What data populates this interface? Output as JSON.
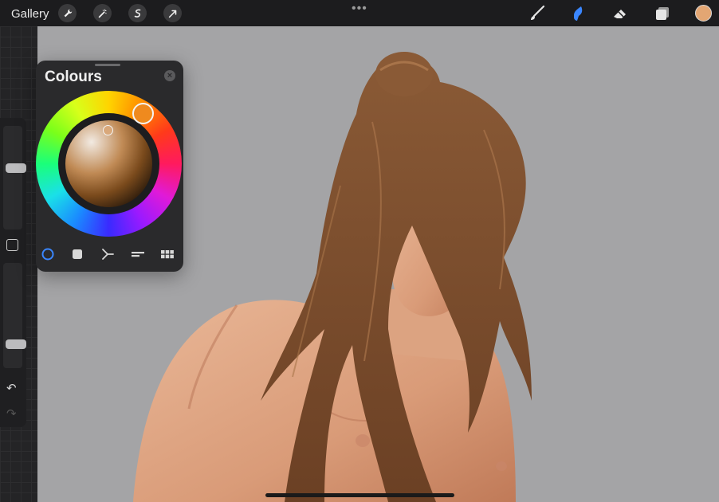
{
  "topbar": {
    "gallery_label": "Gallery",
    "actions": [
      "wrench-icon",
      "magic-wand-icon",
      "selection-icon",
      "transform-arrow-icon"
    ],
    "more_glyph": "•••",
    "tools": [
      "brush-icon",
      "smudge-icon",
      "eraser-icon",
      "layers-icon"
    ],
    "active_tool": "smudge",
    "current_color": "#e3a673"
  },
  "colours_panel": {
    "title": "Colours",
    "close_glyph": "×",
    "active_mode": "disc",
    "modes": [
      "disc",
      "classic",
      "harmony",
      "value",
      "palettes"
    ],
    "selected_hue_color": "#ef8a1e",
    "selected_color": "#d9a87a"
  },
  "sidebar": {
    "brush_size_level": 0.6,
    "opacity_level": 0.2,
    "undo_glyph": "↶",
    "redo_glyph": "↷"
  },
  "colors": {
    "accent": "#3a86ff",
    "canvas_bg": "#a4a4a6",
    "ui_dark": "#1c1c1e"
  }
}
